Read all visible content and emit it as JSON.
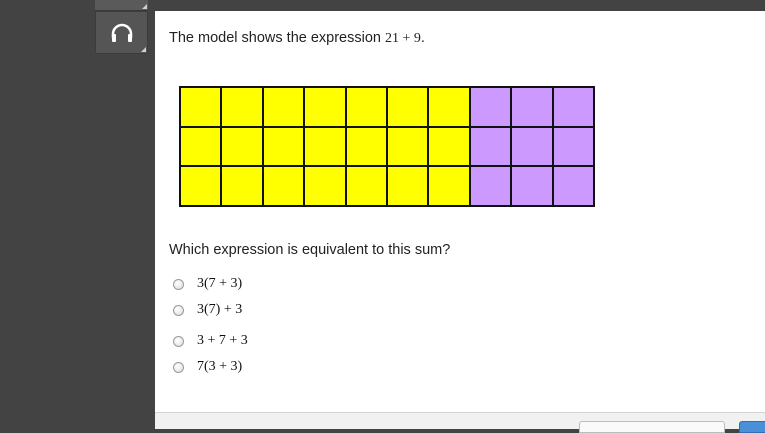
{
  "prompt": {
    "text": "The model shows the expression",
    "expression": "21 + 9",
    "period": "."
  },
  "model": {
    "rows": 3,
    "columns": 10,
    "yellow_columns": 7,
    "purple_columns": 3,
    "colors": {
      "yellow": "#ffff00",
      "purple": "#cc99ff",
      "border": "#111111"
    }
  },
  "question": "Which expression is equivalent to this sum?",
  "choices": [
    {
      "label": "3(7 + 3)"
    },
    {
      "label": "3(7) + 3"
    },
    {
      "label": "3 + 7 + 3"
    },
    {
      "label": "7(3 + 3)"
    }
  ],
  "toolbar": {
    "icon": "headphones-icon"
  }
}
